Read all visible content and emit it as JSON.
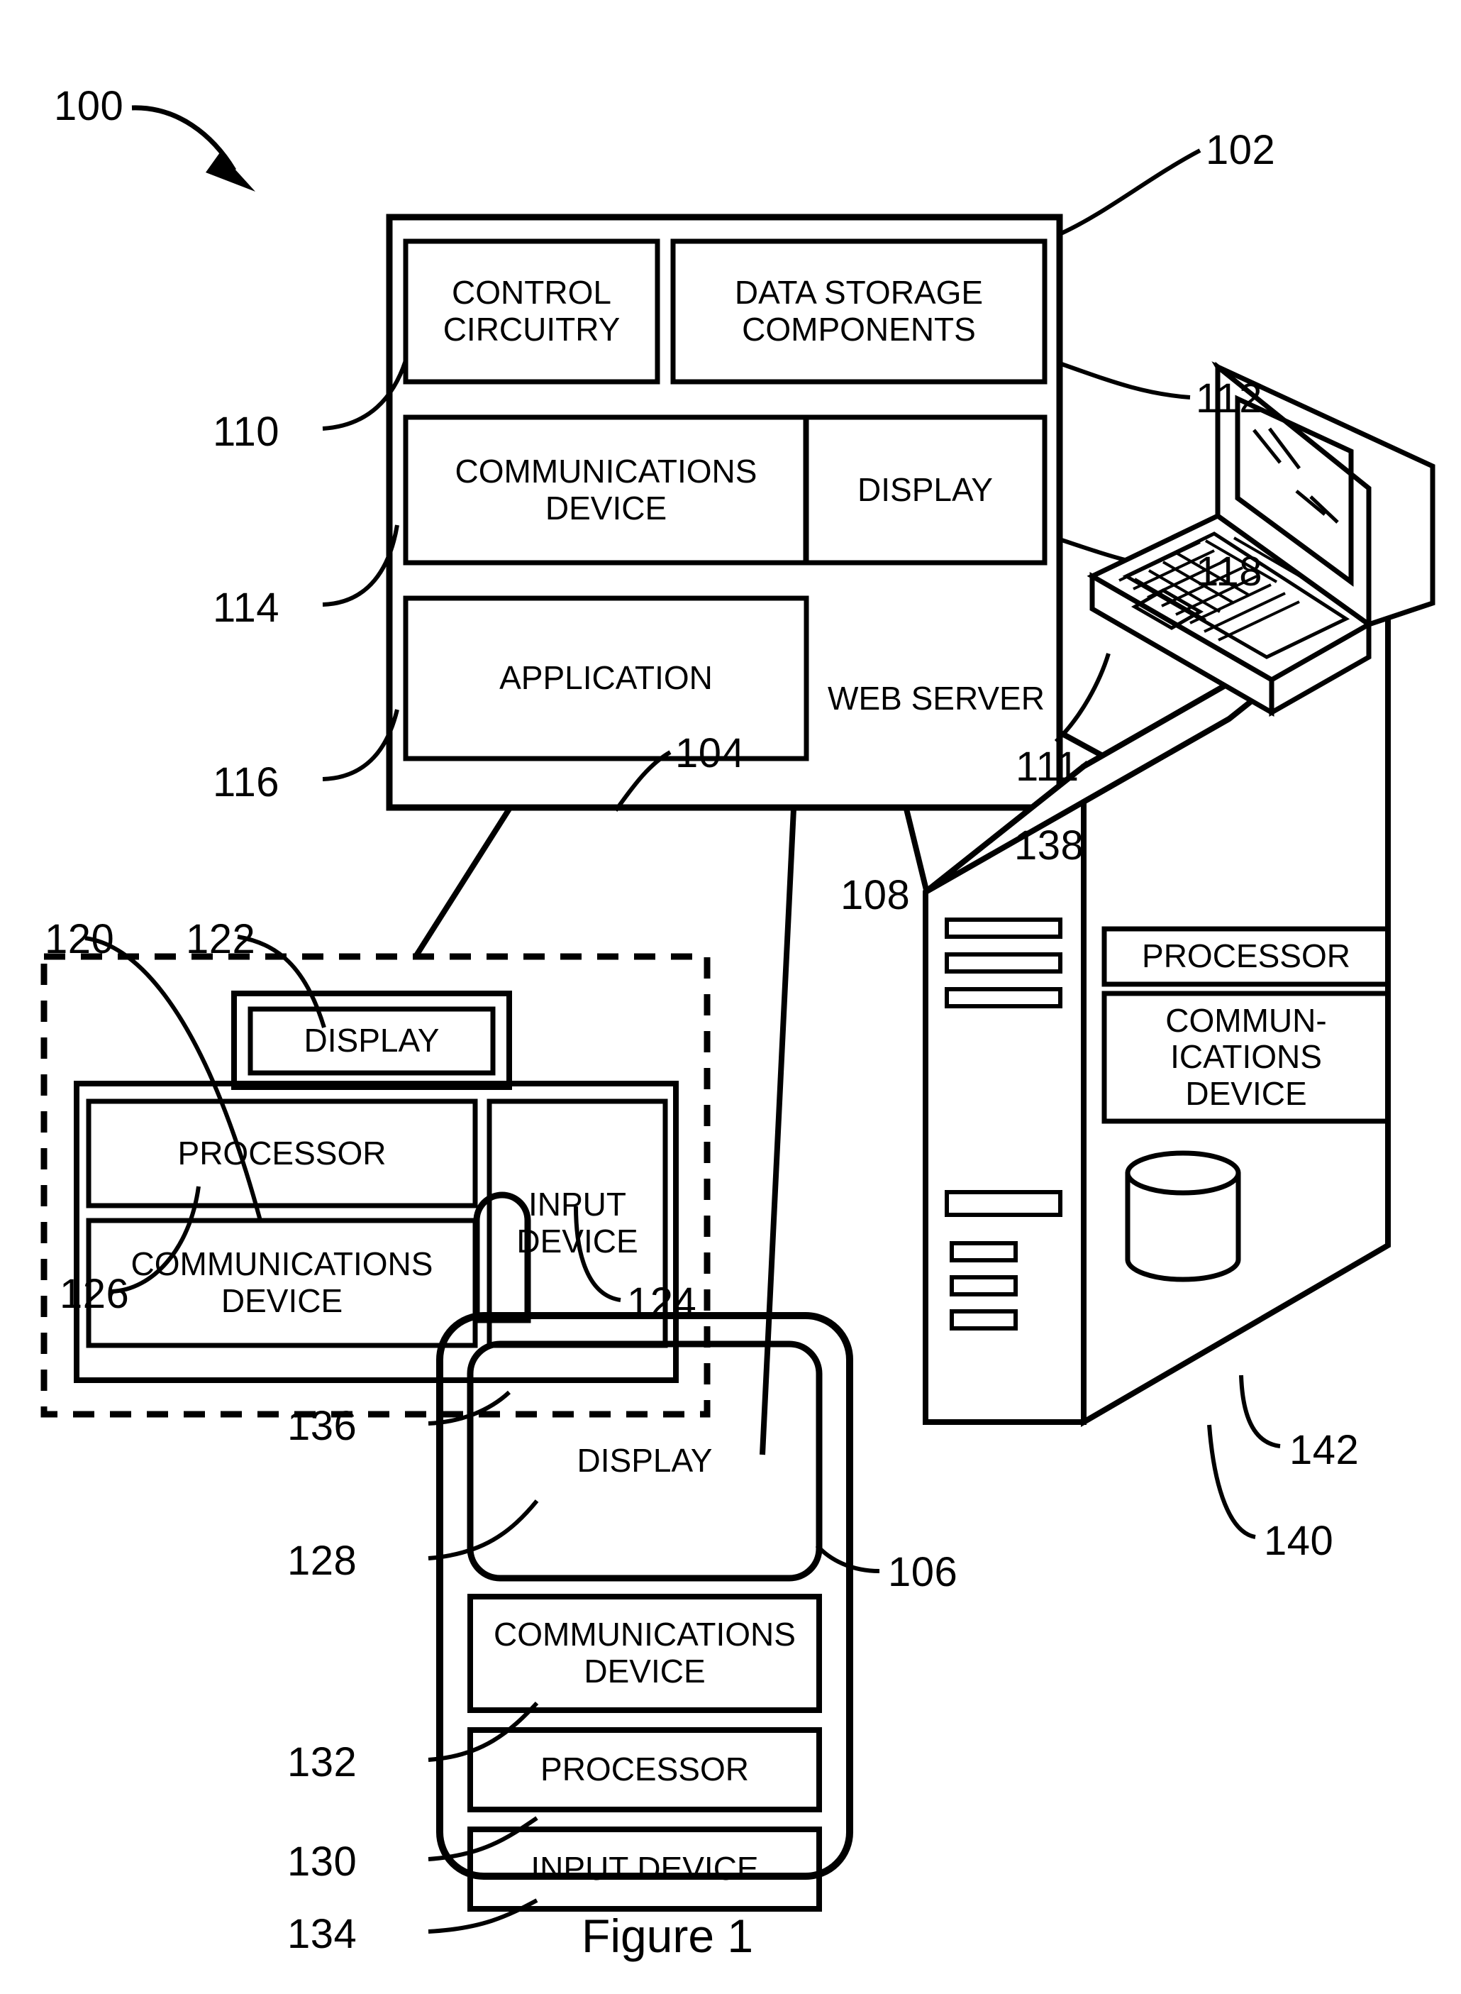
{
  "figure": {
    "caption": "Figure 1",
    "system_ref": "100"
  },
  "system_box": {
    "ref": "102",
    "web_server_label": "WEB SERVER",
    "components": [
      {
        "ref": "110",
        "label": "CONTROL\nCIRCUITRY"
      },
      {
        "ref": "112",
        "label": "DATA STORAGE\nCOMPONENTS"
      },
      {
        "ref": "114",
        "label": "COMMUNICATIONS\nDEVICE"
      },
      {
        "ref": "118",
        "label": "DISPLAY"
      },
      {
        "ref": "116",
        "label": "APPLICATION"
      }
    ]
  },
  "client_computer": {
    "ref": "104",
    "components": [
      {
        "ref": "122",
        "label": "DISPLAY"
      },
      {
        "ref": "120",
        "label": "PROCESSOR"
      },
      {
        "ref": "126",
        "label": "COMMUNICATIONS\nDEVICE"
      },
      {
        "ref": "124",
        "label": "INPUT\nDEVICE"
      }
    ]
  },
  "mobile_device": {
    "ref": "106",
    "antenna_ref": "136",
    "components": [
      {
        "ref": "128",
        "label": "DISPLAY"
      },
      {
        "ref": "132",
        "label": "COMMUNICATIONS\nDEVICE"
      },
      {
        "ref": "130",
        "label": "PROCESSOR"
      },
      {
        "ref": "134",
        "label": "INPUT DEVICE"
      }
    ]
  },
  "server": {
    "ref": "108",
    "components": [
      {
        "ref": "138",
        "label": "PROCESSOR"
      },
      {
        "ref": "140",
        "label": "COMMUN-\nICATIONS\nDEVICE"
      },
      {
        "ref": "142",
        "label": ""
      }
    ]
  },
  "laptop": {
    "ref": "111"
  },
  "colors": {
    "ink": "#000000",
    "paper": "#ffffff"
  }
}
